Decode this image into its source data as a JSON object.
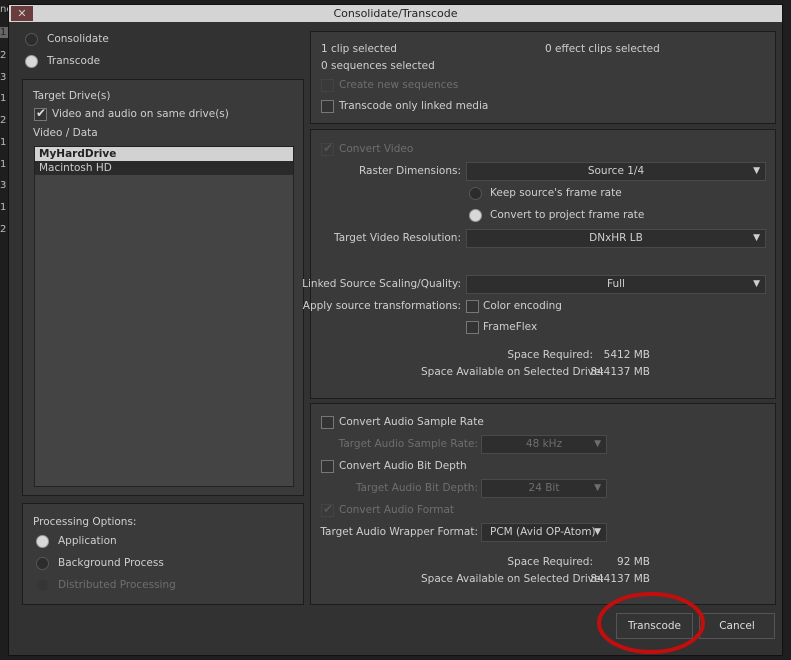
{
  "background": {
    "partial_text": [
      "ne",
      "1",
      "2",
      "3",
      "1",
      "2",
      "1",
      "1",
      "3",
      "1",
      "2"
    ]
  },
  "dialog": {
    "title": "Consolidate/Transcode",
    "close_icon": "close-icon"
  },
  "mode": {
    "options": [
      "Consolidate",
      "Transcode"
    ],
    "selected": "Transcode"
  },
  "target": {
    "heading": "Target Drive(s)",
    "same_drive_label": "Video and audio on same drive(s)",
    "same_drive_checked": true,
    "video_data_label": "Video / Data",
    "drives": [
      "MyHardDrive",
      "Macintosh HD"
    ],
    "selected_drive": "MyHardDrive"
  },
  "processing": {
    "heading": "Processing Options:",
    "options": [
      "Application",
      "Background Process",
      "Distributed Processing"
    ],
    "selected": "Application"
  },
  "selection": {
    "clips": "1 clip selected",
    "effect_clips": "0 effect clips selected",
    "sequences": "0 sequences selected",
    "create_new_sequences": "Create new sequences",
    "transcode_linked": "Transcode only linked media"
  },
  "video": {
    "convert_label": "Convert Video",
    "raster_label": "Raster Dimensions:",
    "raster_value": "Source 1/4",
    "keep_rate": "Keep source's frame rate",
    "convert_rate": "Convert to project frame rate",
    "resolution_label": "Target Video Resolution:",
    "resolution_value": "DNxHR LB",
    "scaling_label": "Linked Source Scaling/Quality:",
    "scaling_value": "Full",
    "transform_label": "Apply source transformations:",
    "color_encoding": "Color encoding",
    "frameflex": "FrameFlex",
    "space_required_label": "Space Required:",
    "space_required": "5412 MB",
    "space_available_label": "Space Available on Selected Drive:",
    "space_available": "844137 MB"
  },
  "audio": {
    "sample_rate_cb": "Convert Audio Sample Rate",
    "sample_rate_label": "Target Audio Sample Rate:",
    "sample_rate_value": "48 kHz",
    "bit_depth_cb": "Convert Audio Bit Depth",
    "bit_depth_label": "Target Audio Bit Depth:",
    "bit_depth_value": "24 Bit",
    "format_cb": "Convert Audio Format",
    "wrapper_label": "Target Audio Wrapper Format:",
    "wrapper_value": "PCM  (Avid OP-Atom)",
    "space_required_label": "Space Required:",
    "space_required": "92 MB",
    "space_available_label": "Space Available on Selected Drive:",
    "space_available": "844137 MB"
  },
  "buttons": {
    "transcode": "Transcode",
    "cancel": "Cancel"
  },
  "annotation": {
    "color": "#c40d0d"
  }
}
